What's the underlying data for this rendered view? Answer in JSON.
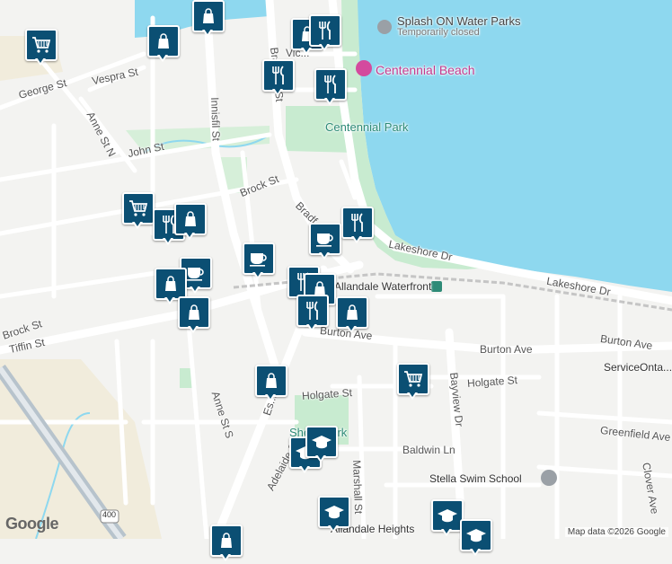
{
  "map": {
    "water_color": "#8ed8ef",
    "park_color": "#c8ebd0",
    "road_color": "#ffffff",
    "marker_color": "#0b4f73",
    "highway_color": "#b7c3cc"
  },
  "streets": {
    "vespra": "Vespra St",
    "george": "George St",
    "john": "John St",
    "anne_n": "Anne St N",
    "innisfil": "Innisfil St",
    "brock_n": "Brock St",
    "brock_w": "Brock St",
    "bradford_top": "Bradford St",
    "bradford_mid": "Bradf...",
    "victoria": "Vic...",
    "lakeshore_1": "Lakeshore Dr",
    "lakeshore_2": "Lakeshore Dr",
    "tiffin": "Tiffin St",
    "burton_1": "Burton Ave",
    "burton_2": "Burton Ave",
    "burton_3": "Burton Ave",
    "holgate_1": "Holgate St",
    "holgate_2": "Holgate St",
    "anne_s": "Anne St S",
    "essa": "Es...",
    "bayview": "Bayview Dr",
    "greenfield": "Greenfield Ave",
    "clover": "Clover Ave",
    "baldwin": "Baldwin Ln",
    "adelaide": "Adelaide St",
    "marshall": "Marshall St",
    "highway": "400"
  },
  "places": {
    "splash_name": "Splash ON Water Parks",
    "splash_status": "Temporarily closed",
    "centennial_beach": "Centennial Beach",
    "centennial_park": "Centennial Park",
    "allandale": "Allandale Waterfront",
    "serviceontario": "ServiceOnta...",
    "stella": "Stella Swim School",
    "park_south": "She... Park",
    "allandale_heights": "Allandale Heights"
  },
  "markers": [
    {
      "icon": "shopping-bag-icon"
    },
    {
      "icon": "cart-icon"
    },
    {
      "icon": "shopping-bag-icon"
    },
    {
      "icon": "restaurant-icon"
    },
    {
      "icon": "shopping-bag-icon"
    },
    {
      "icon": "restaurant-icon"
    },
    {
      "icon": "restaurant-icon"
    },
    {
      "icon": "cart-icon"
    },
    {
      "icon": "restaurant-icon"
    },
    {
      "icon": "shopping-bag-icon"
    },
    {
      "icon": "restaurant-icon"
    },
    {
      "icon": "coffee-icon"
    },
    {
      "icon": "coffee-icon"
    },
    {
      "icon": "coffee-icon"
    },
    {
      "icon": "shopping-bag-icon"
    },
    {
      "icon": "restaurant-icon"
    },
    {
      "icon": "shopping-bag-icon"
    },
    {
      "icon": "shopping-bag-icon"
    },
    {
      "icon": "restaurant-icon"
    },
    {
      "icon": "shopping-bag-icon"
    },
    {
      "icon": "shopping-bag-icon"
    },
    {
      "icon": "cart-icon"
    },
    {
      "icon": "school-icon"
    },
    {
      "icon": "school-icon"
    },
    {
      "icon": "school-icon"
    },
    {
      "icon": "school-icon"
    },
    {
      "icon": "school-icon"
    },
    {
      "icon": "shopping-bag-icon"
    }
  ],
  "footer": {
    "google": "Google",
    "attribution": "Map data ©2026 Google"
  }
}
